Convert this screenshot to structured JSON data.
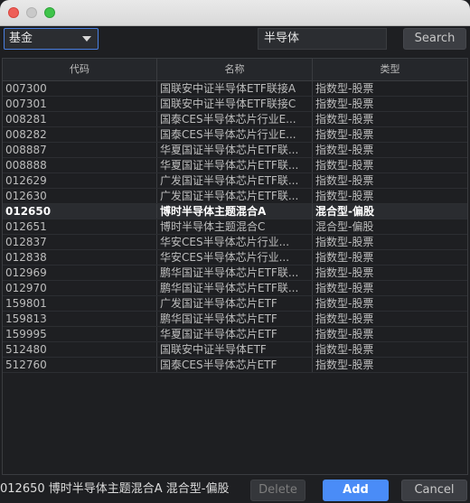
{
  "filter": {
    "category": "基金",
    "search_value": "半导体",
    "search_button": "Search"
  },
  "table": {
    "headers": [
      "代码",
      "名称",
      "类型"
    ],
    "rows": [
      {
        "code": "007300",
        "name": "国联安中证半导体ETF联接A",
        "type": "指数型-股票"
      },
      {
        "code": "007301",
        "name": "国联安中证半导体ETF联接C",
        "type": "指数型-股票"
      },
      {
        "code": "008281",
        "name": "国泰CES半导体芯片行业E...",
        "type": "指数型-股票"
      },
      {
        "code": "008282",
        "name": "国泰CES半导体芯片行业E...",
        "type": "指数型-股票"
      },
      {
        "code": "008887",
        "name": "华夏国证半导体芯片ETF联...",
        "type": "指数型-股票"
      },
      {
        "code": "008888",
        "name": "华夏国证半导体芯片ETF联...",
        "type": "指数型-股票"
      },
      {
        "code": "012629",
        "name": "广发国证半导体芯片ETF联...",
        "type": "指数型-股票"
      },
      {
        "code": "012630",
        "name": "广发国证半导体芯片ETF联...",
        "type": "指数型-股票"
      },
      {
        "code": "012650",
        "name": "博时半导体主题混合A",
        "type": "混合型-偏股",
        "selected": true
      },
      {
        "code": "012651",
        "name": "博时半导体主题混合C",
        "type": "混合型-偏股"
      },
      {
        "code": "012837",
        "name": "华安CES半导体芯片行业...",
        "type": "指数型-股票"
      },
      {
        "code": "012838",
        "name": "华安CES半导体芯片行业...",
        "type": "指数型-股票"
      },
      {
        "code": "012969",
        "name": "鹏华国证半导体芯片ETF联...",
        "type": "指数型-股票"
      },
      {
        "code": "012970",
        "name": "鹏华国证半导体芯片ETF联...",
        "type": "指数型-股票"
      },
      {
        "code": "159801",
        "name": "广发国证半导体芯片ETF",
        "type": "指数型-股票"
      },
      {
        "code": "159813",
        "name": "鹏华国证半导体芯片ETF",
        "type": "指数型-股票"
      },
      {
        "code": "159995",
        "name": "华夏国证半导体芯片ETF",
        "type": "指数型-股票"
      },
      {
        "code": "512480",
        "name": "国联安中证半导体ETF",
        "type": "指数型-股票"
      },
      {
        "code": "512760",
        "name": "国泰CES半导体芯片ETF",
        "type": "指数型-股票"
      }
    ]
  },
  "footer": {
    "status": "012650 博时半导体主题混合A 混合型-偏股",
    "delete_label": "Delete",
    "add_label": "Add",
    "cancel_label": "Cancel"
  }
}
